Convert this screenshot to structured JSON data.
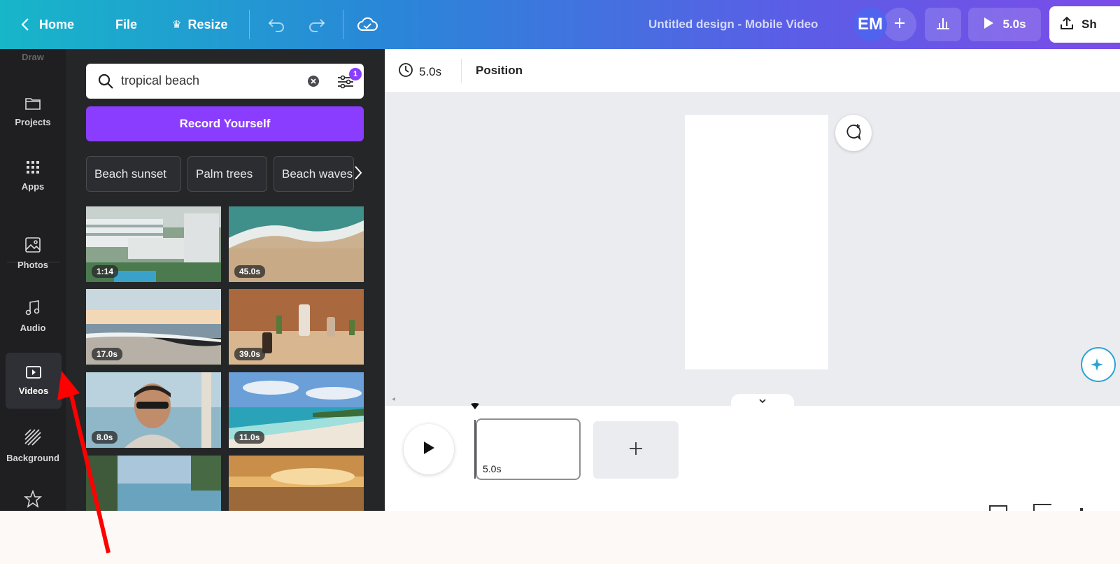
{
  "topbar": {
    "home_label": "Home",
    "file_label": "File",
    "resize_label": "Resize",
    "design_title": "Untitled design - Mobile Video",
    "avatar_initials": "EM",
    "play_duration": "5.0s",
    "share_label": "Sh"
  },
  "leftnav": {
    "items": [
      {
        "label": "Draw"
      },
      {
        "label": "Projects"
      },
      {
        "label": "Apps"
      },
      {
        "label": "Photos"
      },
      {
        "label": "Audio"
      },
      {
        "label": "Videos"
      },
      {
        "label": "Background"
      }
    ]
  },
  "panel": {
    "search_value": "tropical beach",
    "filter_count": "1",
    "record_label": "Record Yourself",
    "chips": [
      "Beach sunset",
      "Palm trees",
      "Beach waves"
    ],
    "videos": [
      {
        "duration": "1:14"
      },
      {
        "duration": "45.0s"
      },
      {
        "duration": "17.0s"
      },
      {
        "duration": "39.0s"
      },
      {
        "duration": "8.0s"
      },
      {
        "duration": "11.0s"
      },
      {
        "duration": ""
      },
      {
        "duration": ""
      }
    ]
  },
  "editor": {
    "duration_label": "5.0s",
    "position_label": "Position",
    "clip_duration": "5.0s"
  },
  "colors": {
    "accent_purple": "#8b3dff",
    "annotation_arrow": "#ff0000"
  }
}
